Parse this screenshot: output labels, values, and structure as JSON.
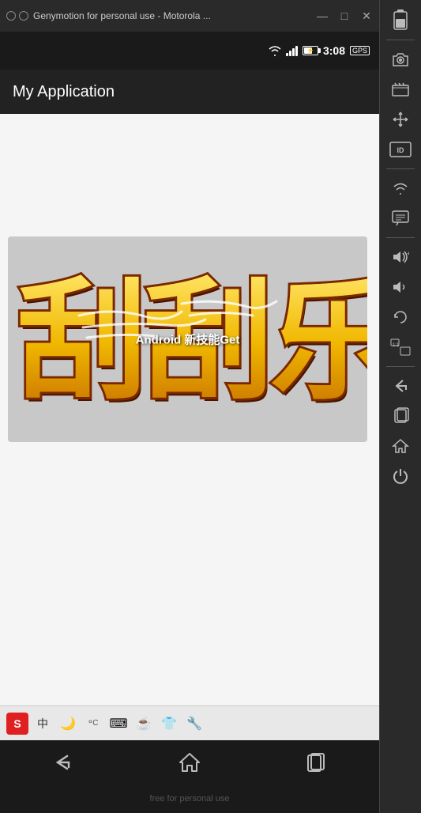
{
  "titlebar": {
    "title": "Genymotion for personal use - Motorola ...",
    "minimize": "—",
    "maximize": "□",
    "close": "✕"
  },
  "statusbar": {
    "time": "3:08",
    "gps_label": "GPS"
  },
  "appbar": {
    "title": "My Application"
  },
  "image": {
    "overlay_text": "Android 新技能Get"
  },
  "ime": {
    "icons": [
      "S",
      "中",
      "🌙",
      "°",
      "⌨",
      "☕",
      "👕",
      "🔧"
    ]
  },
  "navbar": {
    "back": "←",
    "home": "⌂",
    "recents": "▭"
  },
  "watermark": {
    "text": "free for personal use"
  },
  "sidebar": {
    "icons": [
      {
        "name": "battery-icon",
        "symbol": "🔋"
      },
      {
        "name": "camera-icon",
        "symbol": "📷"
      },
      {
        "name": "video-icon",
        "symbol": "🎬"
      },
      {
        "name": "move-icon",
        "symbol": "✛"
      },
      {
        "name": "id-icon",
        "symbol": "ID"
      },
      {
        "name": "wifi-icon",
        "symbol": "📶"
      },
      {
        "name": "chat-icon",
        "symbol": "💬"
      },
      {
        "name": "volume-up-icon",
        "symbol": "🔊"
      },
      {
        "name": "volume-down-icon",
        "symbol": "🔉"
      },
      {
        "name": "rotate-icon",
        "symbol": "⟳"
      },
      {
        "name": "scale-icon",
        "symbol": "⊞"
      },
      {
        "name": "back-icon",
        "symbol": "↩"
      },
      {
        "name": "recents-icon",
        "symbol": "▭"
      },
      {
        "name": "home-icon",
        "symbol": "⌂"
      },
      {
        "name": "power-icon",
        "symbol": "⏻"
      }
    ]
  }
}
